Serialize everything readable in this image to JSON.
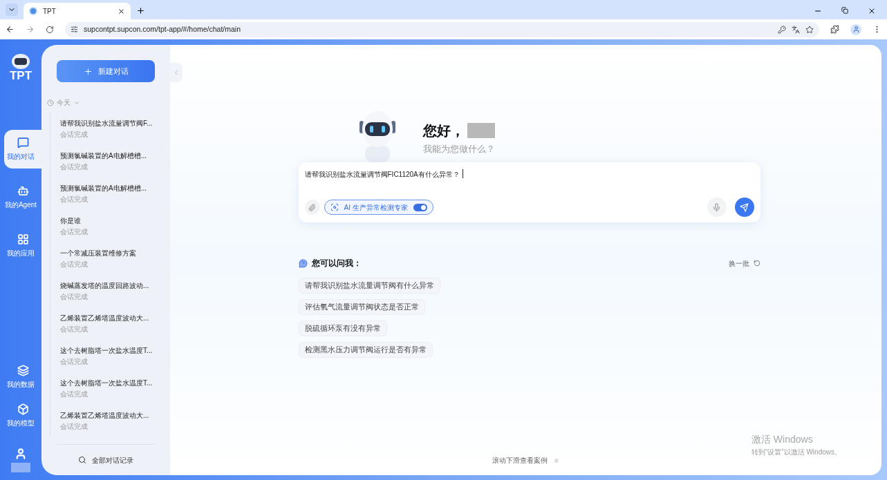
{
  "browser": {
    "tab_title": "TPT",
    "url": "supcontpt.supcon.com/tpt-app/#/home/chat/main"
  },
  "app": {
    "logo_text": "TPT",
    "nav_top": [
      {
        "label": "我的对话",
        "selected": true
      },
      {
        "label": "我的Agent",
        "selected": false
      },
      {
        "label": "我的应用",
        "selected": false
      }
    ],
    "nav_bottom": [
      {
        "label": "我的数据",
        "selected": false
      },
      {
        "label": "我的模型",
        "selected": false
      }
    ]
  },
  "sidebar": {
    "new_chat_button": "新建对话",
    "date_group": "今天",
    "conversations": [
      {
        "title": "请帮我识别盐水流量调节阀F...",
        "status": "会话完成"
      },
      {
        "title": "预测氯碱装置的A电解槽槽...",
        "status": "会话完成"
      },
      {
        "title": "预测氯碱装置的A电解槽槽...",
        "status": "会话完成"
      },
      {
        "title": "你是谁",
        "status": "会话完成"
      },
      {
        "title": "一个常减压装置维修方案",
        "status": "会话完成"
      },
      {
        "title": "烧碱蒸发塔的温度回路波动...",
        "status": "会话完成"
      },
      {
        "title": "乙烯装置乙烯塔温度波动大...",
        "status": "会话完成"
      },
      {
        "title": "这个去树脂塔一次盐水温度T...",
        "status": "会话完成"
      },
      {
        "title": "这个去树脂塔一次盐水温度T...",
        "status": "会话完成"
      },
      {
        "title": "乙烯装置乙烯塔温度波动大...",
        "status": "会话完成"
      }
    ],
    "all_history": "全部对话记录"
  },
  "main": {
    "greeting": "您好，",
    "subtitle": "我能为您做什么？",
    "input": {
      "value": "请帮我识别盐水流量调节阀FIC1120A有什么异常？"
    },
    "agent_chip": {
      "label": "AI 生产异常检测专家",
      "on": true
    },
    "suggestions_title": "您可以问我：",
    "refresh": "换一批",
    "suggestions": [
      "请帮我识别盐水流量调节阀有什么异常",
      "评估氧气流量调节阀状态是否正常",
      "脱硫循环泵有没有异常",
      "检测黑水压力调节阀运行是否有异常"
    ],
    "scroll_hint": "滚动下滑查看案例"
  },
  "os_notice": {
    "title": "激活 Windows",
    "text": "转到“设置”以激活 Windows。"
  }
}
